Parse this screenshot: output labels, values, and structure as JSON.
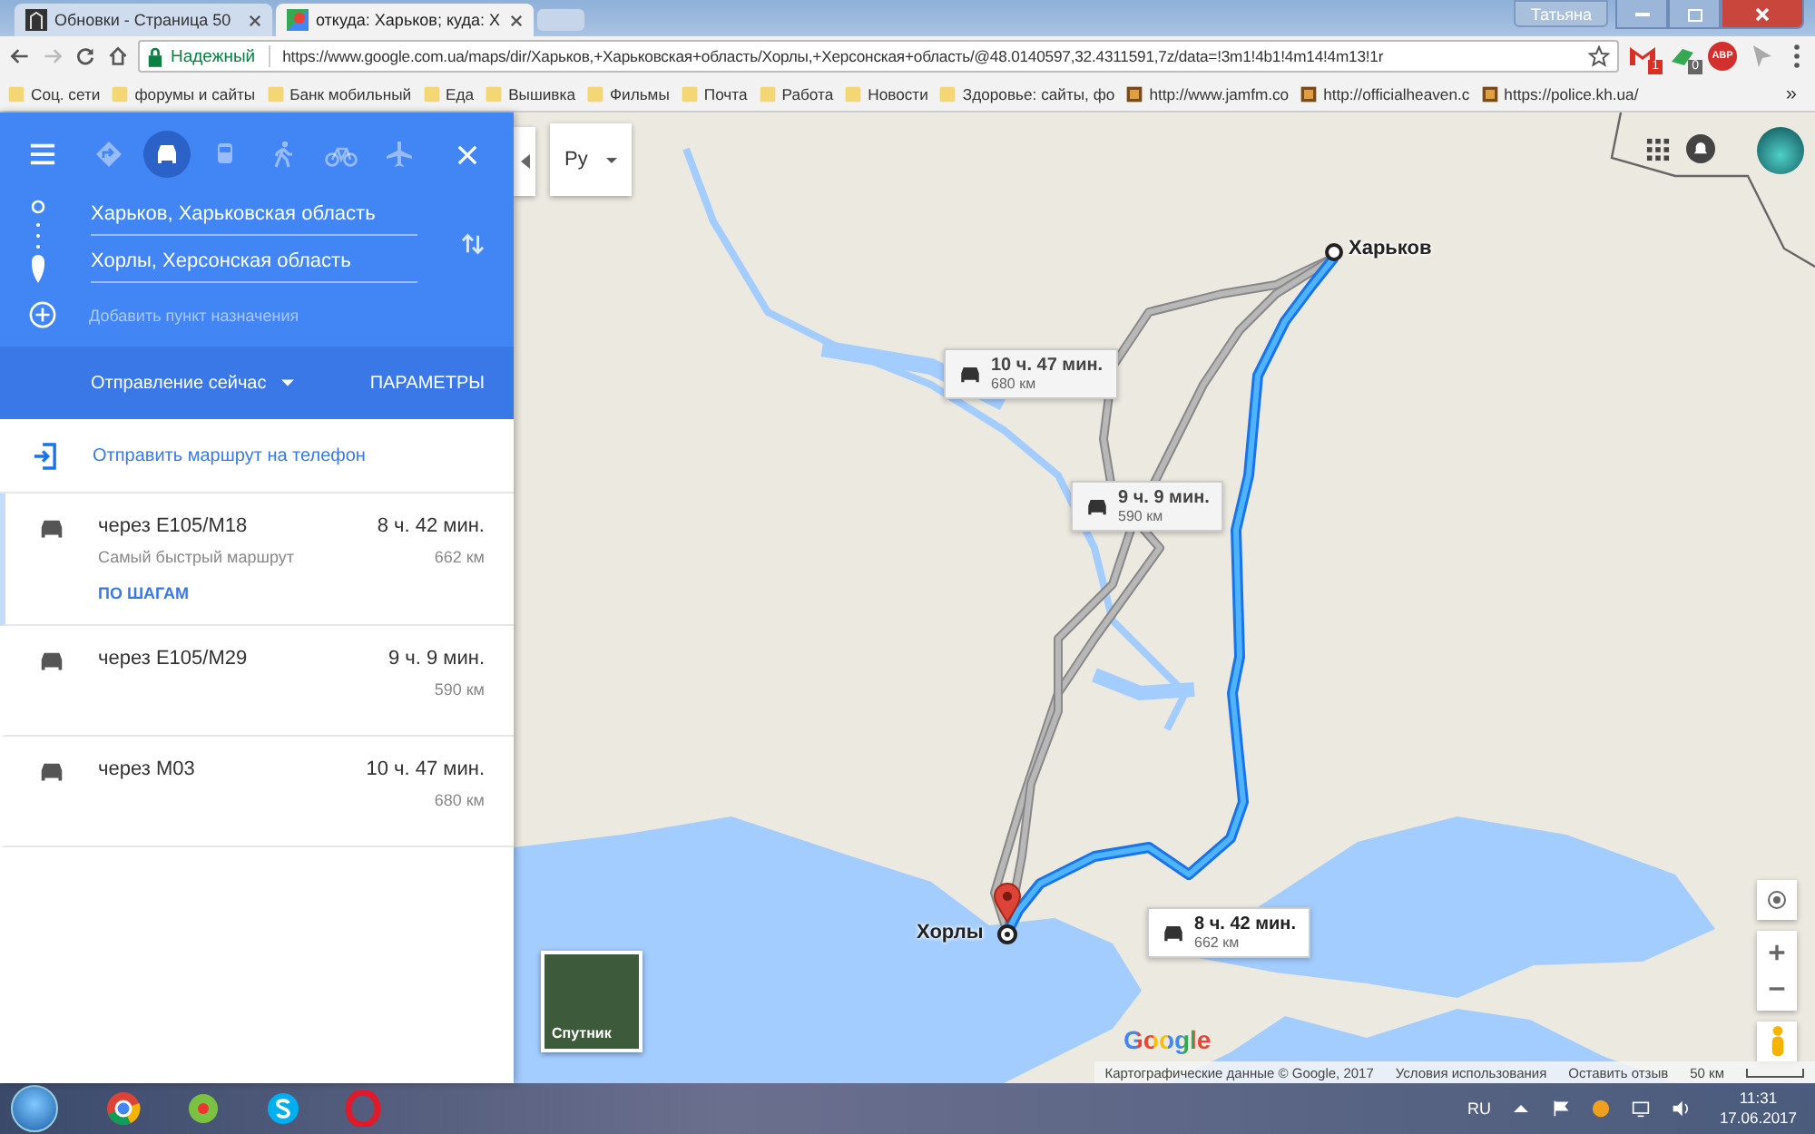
{
  "browser": {
    "tabs": [
      {
        "title": "Обновки - Страница 50",
        "kind": "forum",
        "selected": false
      },
      {
        "title": "откуда: Харьков; куда: Х",
        "kind": "maps",
        "selected": true
      }
    ],
    "profile": "Татьяна",
    "secure_label": "Надежный",
    "url": "https://www.google.com.ua/maps/dir/Харьков,+Харьковская+область/Хорлы,+Херсонская+область/@48.0140597,32.4311591,7z/data=!3m1!4b1!4m14!4m13!1r",
    "extensions": [
      {
        "kind": "mail",
        "badge": "1"
      },
      {
        "kind": "sync",
        "badge": "0"
      },
      {
        "kind": "adblock",
        "badge": "ABP"
      },
      {
        "kind": "cursor"
      }
    ],
    "bookmarks": [
      {
        "title": "Соц. сети",
        "kind": "folder"
      },
      {
        "title": "форумы и сайты",
        "kind": "folder"
      },
      {
        "title": "Банк мобильный",
        "kind": "folder"
      },
      {
        "title": "Еда",
        "kind": "folder"
      },
      {
        "title": "Вышивка",
        "kind": "folder"
      },
      {
        "title": "Фильмы",
        "kind": "folder"
      },
      {
        "title": "Почта",
        "kind": "folder"
      },
      {
        "title": "Работа",
        "kind": "folder"
      },
      {
        "title": "Новости",
        "kind": "folder"
      },
      {
        "title": "Здоровье: сайты, фо",
        "kind": "folder"
      },
      {
        "title": "http://www.jamfm.co",
        "kind": "site"
      },
      {
        "title": "http://officialheaven.c",
        "kind": "site"
      },
      {
        "title": "https://police.kh.ua/",
        "kind": "site"
      }
    ],
    "bookmarks_more": "»"
  },
  "sidebar": {
    "modes": [
      {
        "kind": "best",
        "selected": false
      },
      {
        "kind": "car",
        "selected": true
      },
      {
        "kind": "transit",
        "selected": false
      },
      {
        "kind": "walk",
        "selected": false
      },
      {
        "kind": "bike",
        "selected": false
      },
      {
        "kind": "flight",
        "selected": false
      }
    ],
    "origin": "Харьков, Харьковская область",
    "destination": "Хорлы, Херсонская область",
    "add_placeholder": "Добавить пункт назначения",
    "depart": "Отправление сейчас",
    "options": "ПАРАМЕТРЫ",
    "send": "Отправить маршрут на телефон",
    "routes": [
      {
        "via": "через E105/M18",
        "time": "8 ч. 42 мин.",
        "distance": "662 км",
        "note": "Самый быстрый маршрут",
        "link": "ПО ШАГАМ",
        "selected": true
      },
      {
        "via": "через E105/M29",
        "time": "9 ч. 9 мин.",
        "distance": "590 км",
        "selected": false
      },
      {
        "via": "через M03",
        "time": "10 ч. 47 мин.",
        "distance": "680 км",
        "selected": false
      }
    ]
  },
  "map": {
    "language": "Ру",
    "start_label": "Харьков",
    "end_label": "Хорлы",
    "callouts": [
      {
        "time": "8 ч. 42 мин.",
        "distance": "662 км",
        "selected": true
      },
      {
        "time": "9 ч. 9 мин.",
        "distance": "590 км",
        "selected": false
      },
      {
        "time": "10 ч. 47 мин.",
        "distance": "680 км",
        "selected": false
      }
    ],
    "satellite": "Спутник",
    "logo": "Google",
    "attribution": [
      "Картографические данные © Google, 2017",
      "Условия использования",
      "Оставить отзыв"
    ],
    "scale": "50 км"
  },
  "taskbar": {
    "apps": [
      {
        "kind": "chrome"
      },
      {
        "kind": "icq"
      },
      {
        "kind": "skype"
      },
      {
        "kind": "opera"
      }
    ],
    "language": "RU",
    "time": "11:31",
    "date": "17.06.2017"
  }
}
